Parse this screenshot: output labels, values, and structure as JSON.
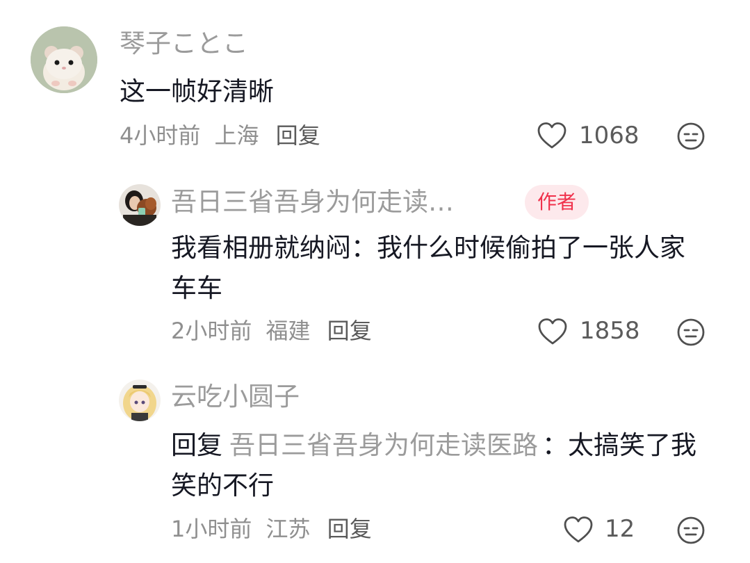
{
  "comments": [
    {
      "username": "琴子ことこ",
      "text": "这一帧好清晰",
      "time": "4小时前",
      "location": "上海",
      "reply_label": "回复",
      "likes": "1068"
    },
    {
      "username": "吾日三省吾身为何走读…",
      "badge": "作者",
      "text": "我看相册就纳闷：我什么时候偷拍了一张人家车车",
      "time": "2小时前",
      "location": "福建",
      "reply_label": "回复",
      "likes": "1858"
    },
    {
      "username": "云吃小圆子",
      "reply_prefix": "回复",
      "reply_to": "吾日三省吾身为何走读医路",
      "reply_sep": "：",
      "text": "太搞笑了我笑的不行",
      "time": "1小时前",
      "location": "江苏",
      "reply_label": "回复",
      "likes": "12"
    }
  ],
  "icons": {
    "like": "heart-outline-icon",
    "dislike": "neutral-face-icon"
  },
  "colors": {
    "badge_text": "#f0314b",
    "badge_bg": "#fde9ec"
  }
}
